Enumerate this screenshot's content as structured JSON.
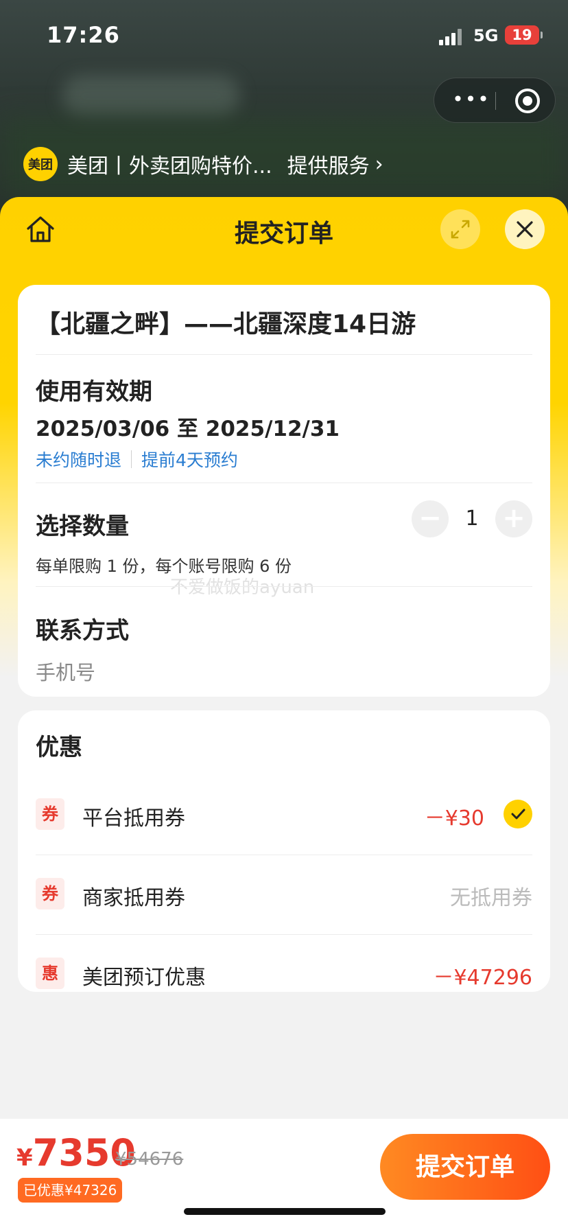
{
  "status_bar": {
    "time": "17:26",
    "network": "5G",
    "battery": "19"
  },
  "provider": {
    "logo_text": "美团",
    "name": "美团丨外卖团购特价...",
    "service_label": "提供服务"
  },
  "sheet": {
    "title": "提交订单"
  },
  "product": {
    "title": "【北疆之畔】——北疆深度14日游"
  },
  "validity": {
    "label": "使用有效期",
    "dates": "2025/03/06 至 2025/12/31",
    "tags": [
      "未约随时退",
      "提前4天预约"
    ]
  },
  "quantity": {
    "label": "选择数量",
    "value": "1",
    "minus_symbol": "−",
    "plus_symbol": "+",
    "limit_text": "每单限购 1 份，每个账号限购 6 份"
  },
  "watermark": "不爱做饭的ayuan",
  "contact": {
    "label": "联系方式",
    "phone_placeholder": "手机号"
  },
  "discounts": {
    "title": "优惠",
    "items": [
      {
        "badge": "券",
        "label": "平台抵用券",
        "amount": "－¥30",
        "selected": true
      },
      {
        "badge": "券",
        "label": "商家抵用券",
        "amount": "无抵用券"
      },
      {
        "badge": "惠",
        "label": "美团预订优惠",
        "amount": "－¥47296"
      }
    ]
  },
  "footer": {
    "currency": "¥",
    "price": "7350",
    "original_price": "¥54676",
    "saved_text": "已优惠¥47326",
    "submit_label": "提交订单"
  },
  "colors": {
    "brand_yellow": "#ffd100",
    "discount_red": "#e63a2e",
    "link_blue": "#2a7dd1",
    "submit_orange": "#ff5a18"
  },
  "icons": [
    "home-icon",
    "expand-icon",
    "close-icon",
    "more-icon",
    "target-icon",
    "chevron-right-icon",
    "check-icon"
  ]
}
